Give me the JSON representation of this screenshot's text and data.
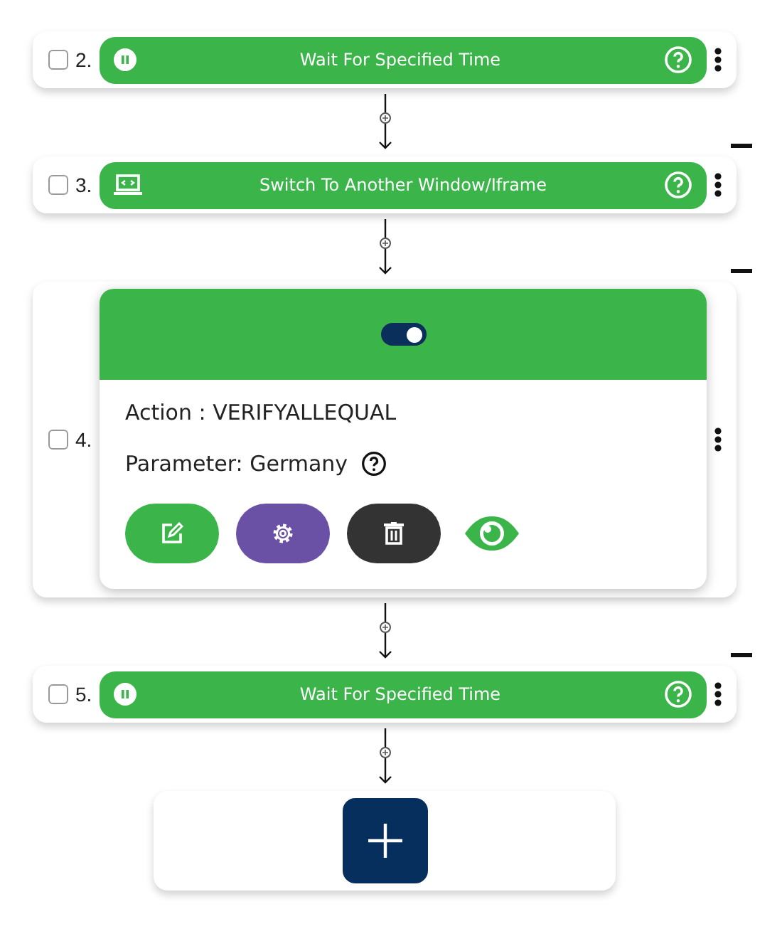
{
  "steps": [
    {
      "kind": "wait",
      "checked": false,
      "number": "2.",
      "title": "Wait For Specified Time",
      "dash": false
    },
    {
      "kind": "switch",
      "checked": false,
      "number": "3.",
      "title": "Switch To Another Window/Iframe",
      "dash": true
    },
    {
      "kind": "expanded",
      "checked": false,
      "number": "4.",
      "toggle_on": true,
      "action": "Action : VERIFYALLEQUAL",
      "parameter": "Parameter: Germany",
      "dash": true
    },
    {
      "kind": "wait",
      "checked": false,
      "number": "5.",
      "title": "Wait For Specified Time",
      "dash": true
    }
  ]
}
